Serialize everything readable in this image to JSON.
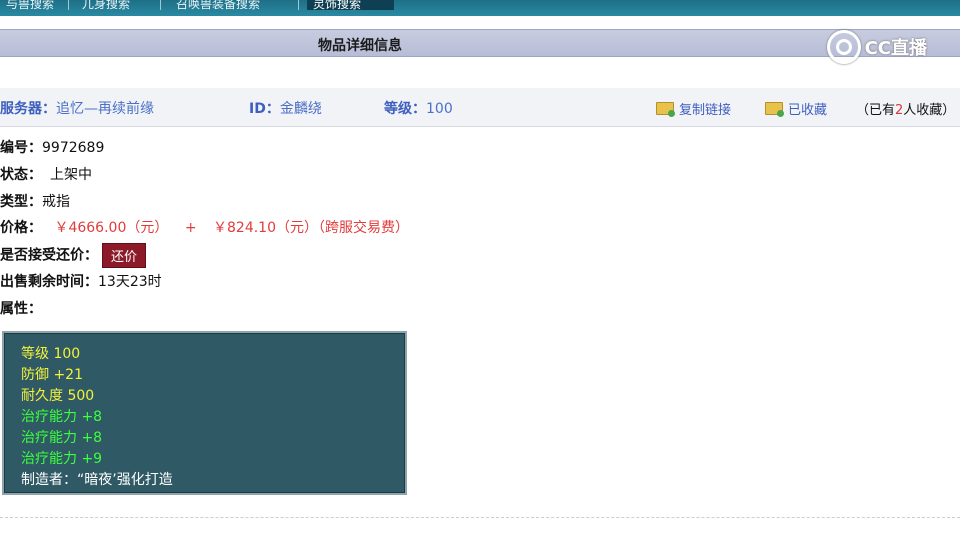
{
  "tabs": [
    {
      "label": "与兽搜索",
      "active": false
    },
    {
      "label": "兀身搜索",
      "active": false
    },
    {
      "label": "召唤兽装备搜索",
      "active": false
    },
    {
      "label": "灵饰搜索",
      "active": true
    }
  ],
  "header": {
    "title": "物品详细信息"
  },
  "logo": {
    "text": "CC直播",
    "icon": "cc-live-logo-icon"
  },
  "info_row": {
    "server_label": "服务器：",
    "server_value": "追忆—再续前缘",
    "id_label": "ID：",
    "id_value": "金麟绕",
    "level_label": "等级：",
    "level_value": "100",
    "copy_link_label": "复制链接",
    "favorited_label": "已收藏",
    "collect_count": {
      "prefix": "（已有",
      "number": "2",
      "suffix": "人收藏）"
    }
  },
  "details": {
    "number_label": "编号：",
    "number_value": "9972689",
    "status_label": "状态：",
    "status_value": "上架中",
    "type_label": "类型：",
    "type_value": "戒指",
    "price_label": "价格：",
    "price_value": "￥4666.00（元）",
    "price_plus": "+",
    "fee_value": "￥824.10（元）（跨服交易费）",
    "bargain_label": "是否接受还价：",
    "bargain_button": "还价",
    "remaining_label": "出售剩余时间：",
    "remaining_value": "13天23时",
    "attributes_label": "属性："
  },
  "attributes": [
    {
      "text": "等级 100",
      "color": "#f2f23a"
    },
    {
      "text": "防御 +21",
      "color": "#f2f23a"
    },
    {
      "text": "耐久度 500",
      "color": "#f2f23a"
    },
    {
      "text": "治疗能力 +8",
      "color": "#3dff3d"
    },
    {
      "text": "治疗能力 +8",
      "color": "#3dff3d"
    },
    {
      "text": "治疗能力 +9",
      "color": "#3dff3d"
    },
    {
      "text": "制造者：“暗夜’强化打造",
      "color": "#ffffff"
    }
  ]
}
